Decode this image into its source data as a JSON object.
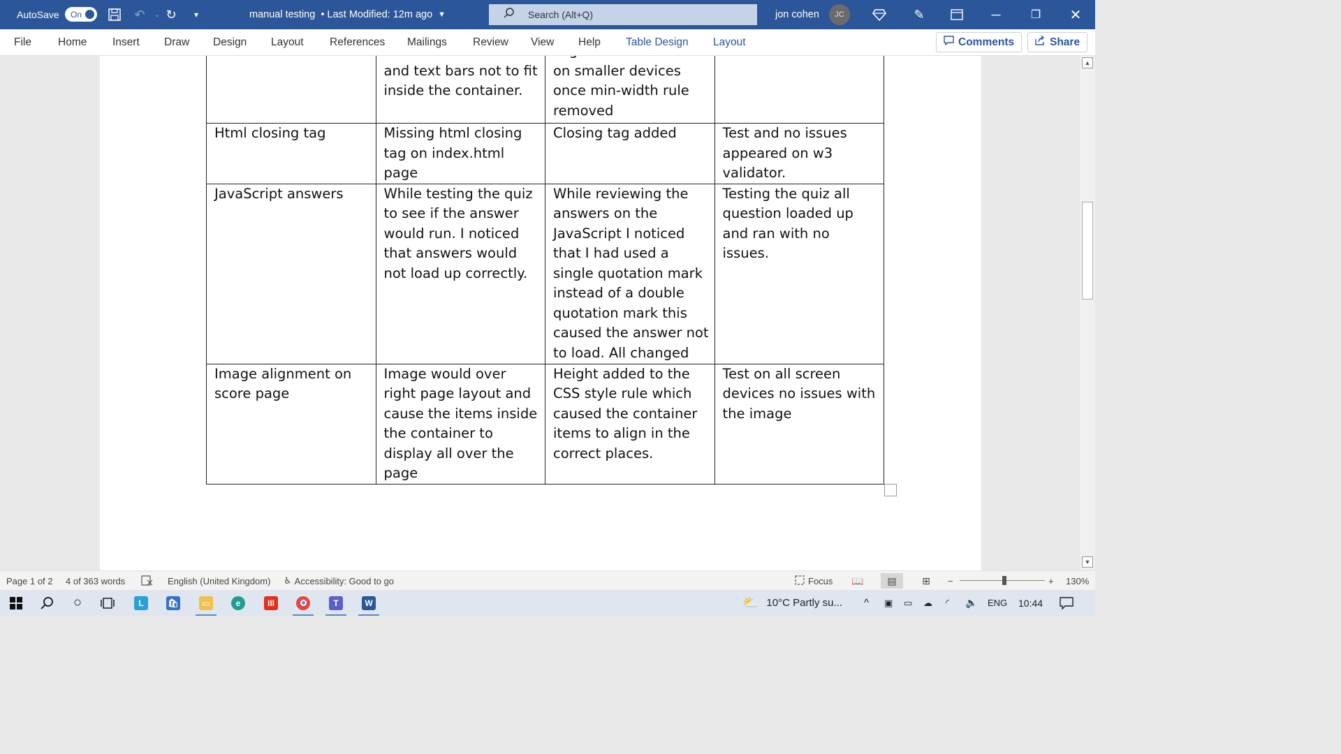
{
  "titlebar": {
    "autosave_label": "AutoSave",
    "autosave_state": "On",
    "doc_title": "manual testing",
    "last_modified": "• Last Modified: 12m ago",
    "search_placeholder": "Search (Alt+Q)",
    "user_name": "jon cohen",
    "user_initials": "JC",
    "accent_color": "#2b579a"
  },
  "ribbon": {
    "tabs": [
      "File",
      "Home",
      "Insert",
      "Draw",
      "Design",
      "Layout",
      "References",
      "Mailings",
      "Review",
      "View",
      "Help",
      "Table Design",
      "Layout"
    ],
    "comments_label": "Comments",
    "share_label": "Share"
  },
  "table": {
    "rows": [
      [
        "",
        "which caused buttons and text bars not to fit inside the container.",
        "alignment seems to fit on smaller devices once min-width rule removed",
        ""
      ],
      [
        "Html closing tag",
        "Missing html closing tag on index.html page",
        "Closing tag added",
        "Test and no issues appeared on w3 validator."
      ],
      [
        "JavaScript answers",
        "While testing the quiz to see if the answer would run. I noticed that answers would not load up correctly.",
        "While reviewing the answers on the JavaScript I noticed that I had used a single quotation mark instead of a double quotation mark this caused the answer not to load. All changed",
        "Testing the quiz all question loaded up and ran with no issues."
      ],
      [
        "Image alignment on score page",
        "Image would over right page layout and cause the items inside the container to display all over the page",
        "Height added to the CSS style rule which caused the container items to align in the correct places.",
        "Test on all screen devices no issues with the image"
      ]
    ]
  },
  "statusbar": {
    "page": "Page 1 of 2",
    "words": "4 of 363 words",
    "language": "English (United Kingdom)",
    "accessibility": "Accessibility: Good to go",
    "focus": "Focus",
    "zoom_minus": "−",
    "zoom_plus": "+",
    "zoom": "130%"
  },
  "taskbar": {
    "weather": "10°C  Partly su...",
    "lang": "ENG",
    "time": "10:44"
  }
}
